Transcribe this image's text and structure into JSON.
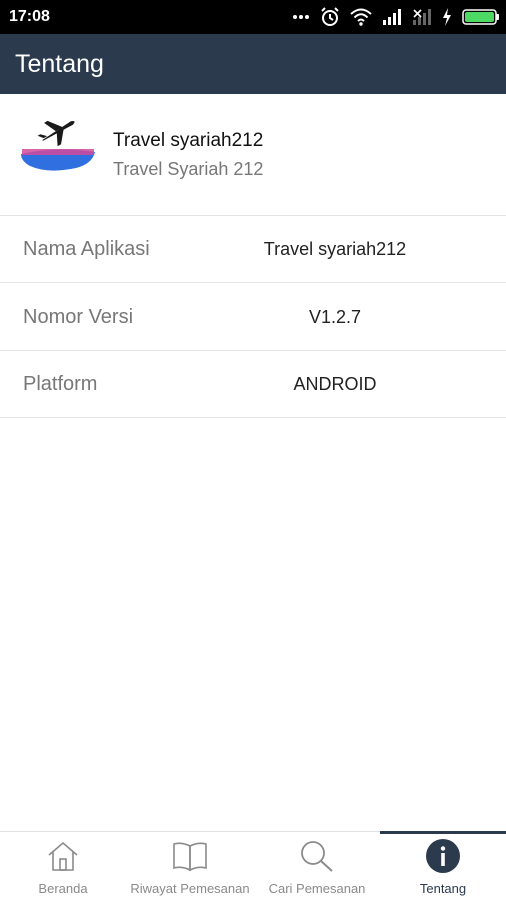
{
  "status_bar": {
    "time": "17:08",
    "icons": [
      "more-dots-icon",
      "alarm-icon",
      "wifi-icon",
      "signal-icon",
      "signal-off-icon",
      "charging-icon",
      "battery-icon"
    ]
  },
  "app_bar": {
    "title": "Tentang"
  },
  "app_info": {
    "name": "Travel syariah212",
    "subtitle": "Travel Syariah 212"
  },
  "rows": [
    {
      "label": "Nama Aplikasi",
      "value": "Travel syariah212"
    },
    {
      "label": "Nomor Versi",
      "value": "V1.2.7"
    },
    {
      "label": "Platform",
      "value": "ANDROID"
    }
  ],
  "nav": {
    "items": [
      {
        "label": "Beranda",
        "icon": "home-icon"
      },
      {
        "label": "Riwayat Pemesanan",
        "icon": "book-icon"
      },
      {
        "label": "Cari Pemesanan",
        "icon": "search-icon"
      },
      {
        "label": "Tentang",
        "icon": "info-icon",
        "active": true
      }
    ]
  },
  "colors": {
    "primary": "#2b3a4d",
    "battery": "#4cd964"
  }
}
